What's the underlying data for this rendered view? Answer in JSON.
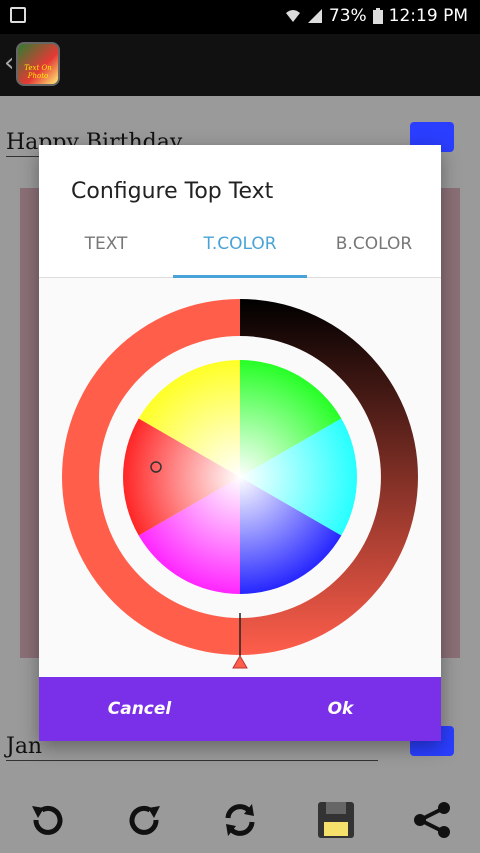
{
  "status_bar": {
    "battery": "73%",
    "time": "12:19 PM",
    "icons": [
      "image-icon",
      "wifi-icon",
      "signal-icon",
      "battery-icon"
    ]
  },
  "toolbar": {
    "logo_text": "Text On Photo",
    "icons": [
      "back-chevron-icon"
    ]
  },
  "background": {
    "top_text_value": "Happy Birthday",
    "bottom_text_value": "Jan"
  },
  "dialog": {
    "title": "Configure Top Text",
    "tabs": [
      {
        "label": "TEXT",
        "active": false
      },
      {
        "label": "T.COLOR",
        "active": true
      },
      {
        "label": "B.COLOR",
        "active": false
      }
    ],
    "cancel_label": "Cancel",
    "ok_label": "Ok",
    "selected_color": "#ff5e4b",
    "accent_color": "#4aa3d8",
    "button_bar_color": "#7a2fe8"
  },
  "bottom_bar": {
    "icons": [
      "undo-icon",
      "redo-icon",
      "refresh-icon",
      "save-icon",
      "share-icon"
    ]
  }
}
